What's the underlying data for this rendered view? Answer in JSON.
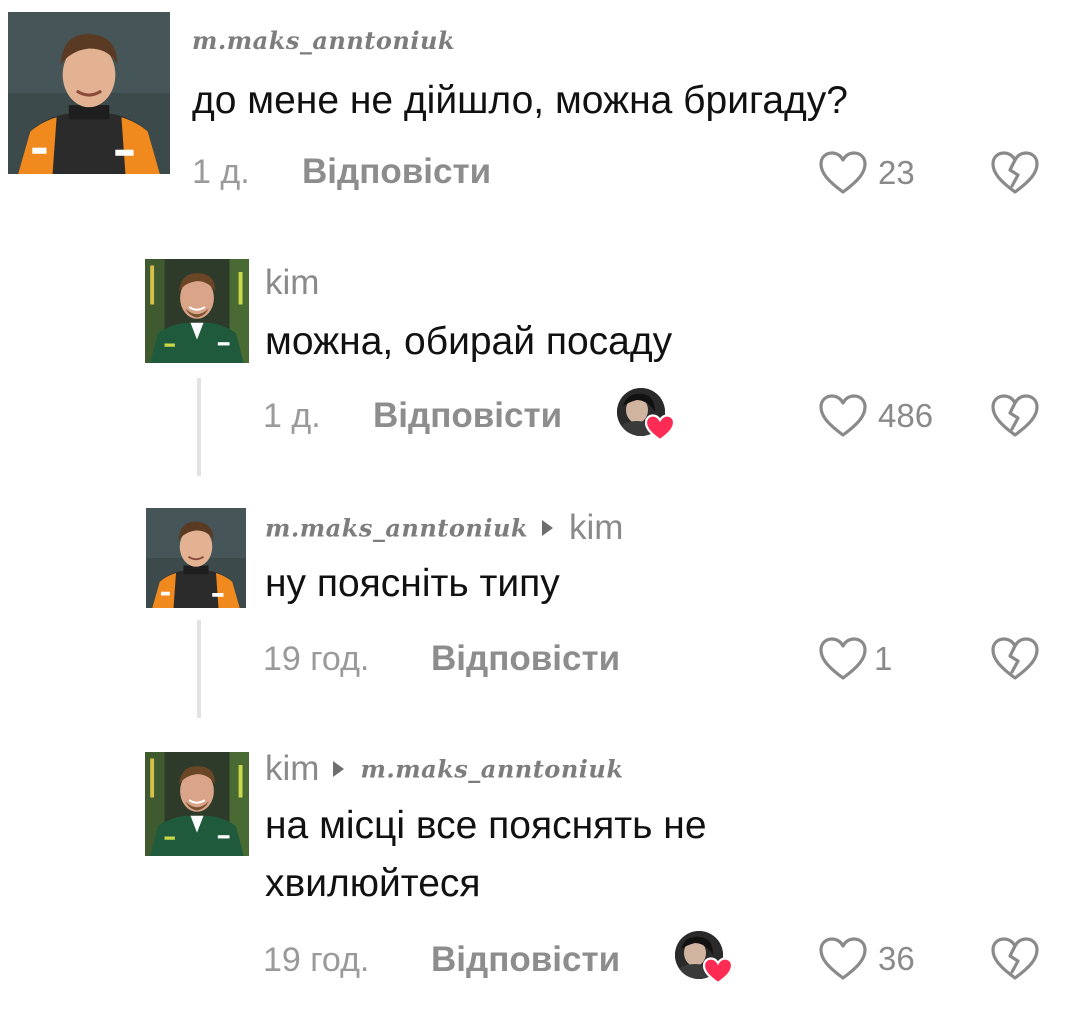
{
  "comments": [
    {
      "username": "m.maks_anntoniuk",
      "text": "до мене не дійшло, можна бригаду?",
      "time": "1 д.",
      "reply_label": "Відповісти",
      "likes": "23",
      "avatar_icon": "avatar-orange-team",
      "creator_liked": false
    },
    {
      "username": "kim",
      "text": "можна, обирай посаду",
      "time": "1 д.",
      "reply_label": "Відповісти",
      "likes": "486",
      "avatar_icon": "avatar-green-team",
      "creator_liked": true
    },
    {
      "username": "m.maks_anntoniuk",
      "reply_to": "kim",
      "text": "ну поясніть типу",
      "time": "19 год.",
      "reply_label": "Відповісти",
      "likes": "1",
      "avatar_icon": "avatar-orange-team",
      "creator_liked": false
    },
    {
      "username": "kim",
      "reply_to": "m.maks_anntoniuk",
      "text_line1": "на місці все пояснять не",
      "text_line2": "хвилюйтеся",
      "time": "19 год.",
      "reply_label": "Відповісти",
      "likes": "36",
      "avatar_icon": "avatar-green-team",
      "creator_liked": true
    }
  ],
  "colors": {
    "orange_team": "#f08a1e",
    "green_team": "#1f5a3c",
    "heart_badge": "#fe2c55",
    "muted_text": "#8a8a8a"
  }
}
